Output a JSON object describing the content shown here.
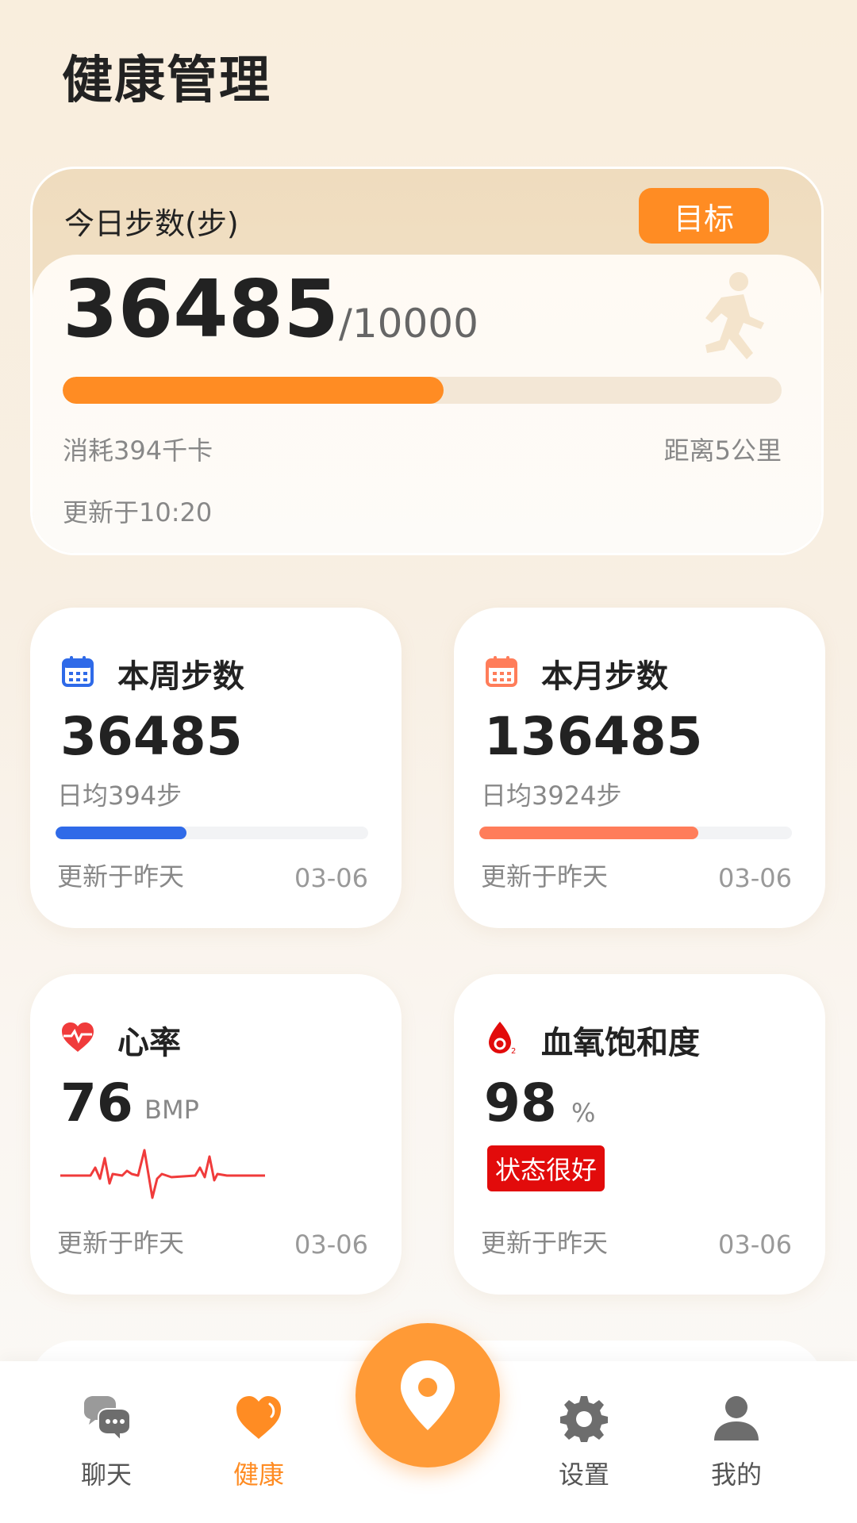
{
  "page": {
    "title": "健康管理"
  },
  "today": {
    "title": "今日步数(步)",
    "goal_button": "目标",
    "steps": "36485",
    "goal": "/10000",
    "progress": 0.53,
    "kcal": "消耗394千卡",
    "distance": "距离5公里",
    "updated": "更新于10:20"
  },
  "week": {
    "title": "本周步数",
    "value": "36485",
    "avg": "日均394步",
    "progress": 0.42,
    "updated": "更新于昨天",
    "date": "03-06",
    "color": "#2f6ae8"
  },
  "month": {
    "title": "本月步数",
    "value": "136485",
    "avg": "日均3924步",
    "progress": 0.7,
    "updated": "更新于昨天",
    "date": "03-06",
    "color": "#ff7d5a"
  },
  "heart": {
    "title": "心率",
    "value": "76",
    "unit": "BMP",
    "updated": "更新于昨天",
    "date": "03-06",
    "color": "#f03b3b"
  },
  "spo2": {
    "title": "血氧饱和度",
    "value": "98",
    "unit": "%",
    "badge": "状态很好",
    "updated": "更新于昨天",
    "date": "03-06",
    "color": "#e20b0b"
  },
  "nav": {
    "chat": "聊天",
    "health": "健康",
    "settings": "设置",
    "mine": "我的",
    "accent": "#ff8c23"
  }
}
